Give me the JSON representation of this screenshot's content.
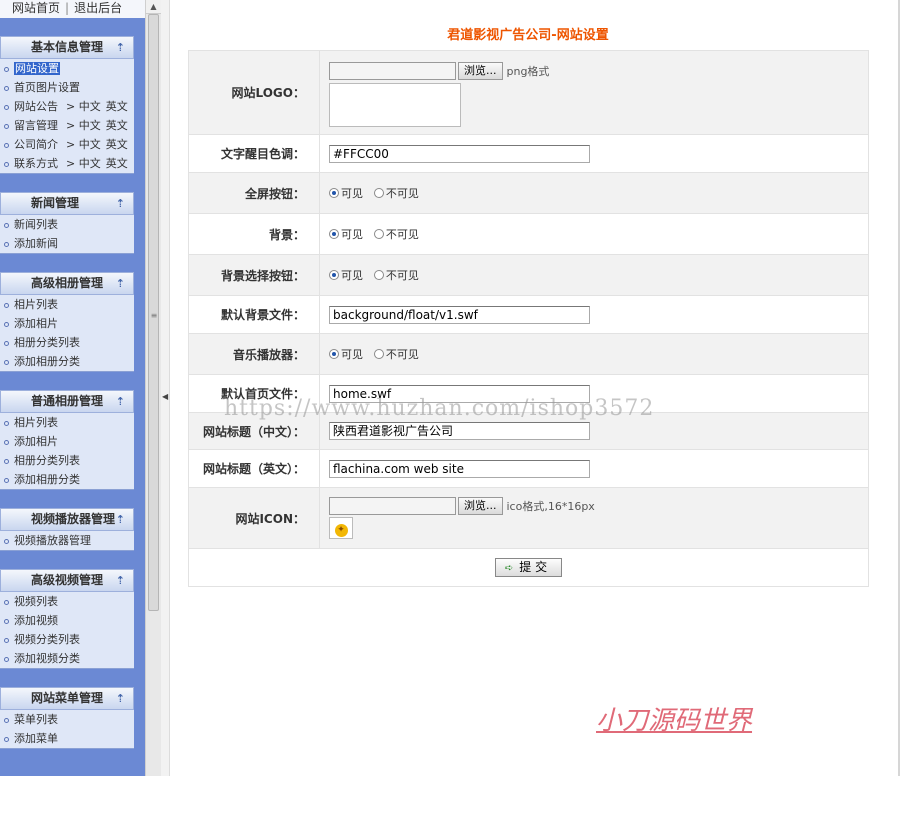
{
  "topnav": {
    "home": "网站首页",
    "separator": "|",
    "logout": "退出后台"
  },
  "sidebar": {
    "groups": [
      {
        "title": "基本信息管理",
        "items": [
          {
            "label": "网站设置",
            "active": true
          },
          {
            "label": "首页图片设置"
          },
          {
            "label": "网站公告",
            "arrow": "> ",
            "zh": "中文",
            "en": "英文"
          },
          {
            "label": "留言管理",
            "arrow": "> ",
            "zh": "中文",
            "en": "英文"
          },
          {
            "label": "公司简介",
            "arrow": "> ",
            "zh": "中文",
            "en": "英文"
          },
          {
            "label": "联系方式",
            "arrow": "> ",
            "zh": "中文",
            "en": "英文"
          }
        ]
      },
      {
        "title": "新闻管理",
        "items": [
          {
            "label": "新闻列表"
          },
          {
            "label": "添加新闻"
          }
        ]
      },
      {
        "title": "高级相册管理",
        "items": [
          {
            "label": "相片列表"
          },
          {
            "label": "添加相片"
          },
          {
            "label": "相册分类列表"
          },
          {
            "label": "添加相册分类"
          }
        ]
      },
      {
        "title": "普通相册管理",
        "items": [
          {
            "label": "相片列表"
          },
          {
            "label": "添加相片"
          },
          {
            "label": "相册分类列表"
          },
          {
            "label": "添加相册分类"
          }
        ]
      },
      {
        "title": "视频播放器管理",
        "items": [
          {
            "label": "视频播放器管理"
          }
        ]
      },
      {
        "title": "高级视频管理",
        "items": [
          {
            "label": "视频列表"
          },
          {
            "label": "添加视频"
          },
          {
            "label": "视频分类列表"
          },
          {
            "label": "添加视频分类"
          }
        ]
      },
      {
        "title": "网站菜单管理",
        "items": [
          {
            "label": "菜单列表"
          },
          {
            "label": "添加菜单"
          }
        ]
      }
    ]
  },
  "main": {
    "title": "君道影视广告公司-网站设置",
    "logo": {
      "label": "网站LOGO：",
      "browse": "浏览...",
      "hint": "png格式"
    },
    "title_color": {
      "label": "文字醒目色调：",
      "value": "#FFCC00"
    },
    "fullscreen": {
      "label": "全屏按钮：",
      "visible": "可见",
      "hidden": "不可见",
      "selected": "visible"
    },
    "background": {
      "label": "背景：",
      "visible": "可见",
      "hidden": "不可见",
      "selected": "visible"
    },
    "bg_select": {
      "label": "背景选择按钮：",
      "visible": "可见",
      "hidden": "不可见",
      "selected": "visible"
    },
    "default_bg": {
      "label": "默认背景文件：",
      "value": "background/float/v1.swf"
    },
    "music": {
      "label": "音乐播放器：",
      "visible": "可见",
      "hidden": "不可见",
      "selected": "visible"
    },
    "home_file": {
      "label": "默认首页文件：",
      "value": "home.swf"
    },
    "title_cn": {
      "label": "网站标题（中文）：",
      "value": "陕西君道影视广告公司"
    },
    "title_en": {
      "label": "网站标题（英文）：",
      "value": "flachina.com web site"
    },
    "icon": {
      "label": "网站ICON：",
      "browse": "浏览...",
      "hint": "ico格式,16*16px"
    },
    "submit": "提 交"
  },
  "overlay": {
    "watermark": "https://www.huzhan.com/ishop3572",
    "signature": "小刀源码世界"
  },
  "colors": {
    "sidebar": "#6b89d4",
    "title": "#ee5500",
    "signature": "#e06a78"
  }
}
